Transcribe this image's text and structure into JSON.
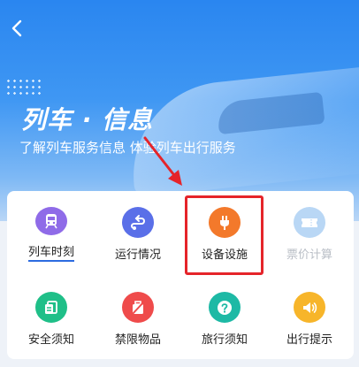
{
  "header": {
    "title": "列车 · 信息",
    "subtitle": "了解列车服务信息 体验列车出行服务",
    "back_icon": "back-icon"
  },
  "colors": {
    "hero_blue": "#2a86f0",
    "highlight_red": "#e5242a",
    "purple": "#8f6be8",
    "indigo": "#5a6fe8",
    "orange": "#f3792b",
    "disabled_blue": "#b9d7f5",
    "green": "#1fbf88",
    "red": "#ef4b4b",
    "teal": "#1db9a5",
    "yellow": "#f7b52a"
  },
  "services": [
    {
      "label": "列车时刻",
      "icon": "train-icon",
      "color": "#8f6be8",
      "enabled": true
    },
    {
      "label": "运行情况",
      "icon": "route-icon",
      "color": "#5a6fe8",
      "enabled": true
    },
    {
      "label": "设备设施",
      "icon": "plug-icon",
      "color": "#f3792b",
      "enabled": true,
      "highlighted": true
    },
    {
      "label": "票价计算",
      "icon": "ticket-icon",
      "color": "#b9d7f5",
      "enabled": false
    },
    {
      "label": "安全须知",
      "icon": "shield-doc-icon",
      "color": "#1fbf88",
      "enabled": true
    },
    {
      "label": "禁限物品",
      "icon": "prohibited-luggage-icon",
      "color": "#ef4b4b",
      "enabled": true
    },
    {
      "label": "旅行须知",
      "icon": "question-icon",
      "color": "#1db9a5",
      "enabled": true
    },
    {
      "label": "出行提示",
      "icon": "speaker-icon",
      "color": "#f7b52a",
      "enabled": true
    }
  ]
}
